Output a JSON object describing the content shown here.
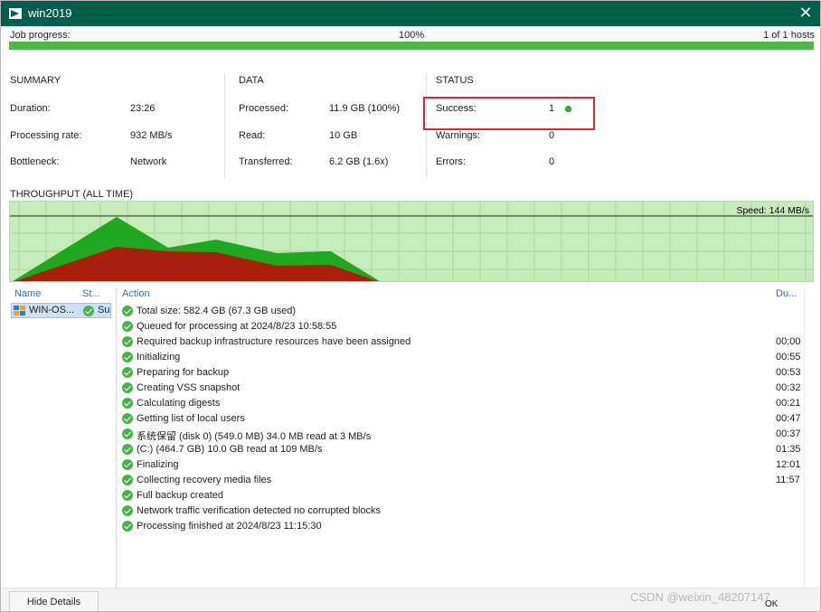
{
  "window": {
    "title": "win2019"
  },
  "job_progress": {
    "label": "Job progress:",
    "percent_label": "100%",
    "hosts": "1 of 1 hosts",
    "fraction": 1.0
  },
  "summary": {
    "header": "SUMMARY",
    "rows": [
      {
        "label": "Duration:",
        "value": "23:26"
      },
      {
        "label": "Processing rate:",
        "value": "932 MB/s"
      },
      {
        "label": "Bottleneck:",
        "value": "Network"
      }
    ]
  },
  "data": {
    "header": "DATA",
    "rows": [
      {
        "label": "Processed:",
        "value": "11.9 GB (100%)"
      },
      {
        "label": "Read:",
        "value": "10 GB"
      },
      {
        "label": "Transferred:",
        "value": "6.2 GB (1.6x)"
      }
    ]
  },
  "status": {
    "header": "STATUS",
    "rows": [
      {
        "label": "Success:",
        "value": "1"
      },
      {
        "label": "Warnings:",
        "value": "0"
      },
      {
        "label": "Errors:",
        "value": "0"
      }
    ]
  },
  "throughput": {
    "title": "THROUGHPUT (ALL TIME)",
    "speed": "Speed: 144 MB/s"
  },
  "vm_list": {
    "col_name": "Name",
    "col_status": "St...",
    "items": [
      {
        "name": "WIN-OS...",
        "status": "Su"
      }
    ]
  },
  "log": {
    "col_action": "Action",
    "col_duration": "Du...",
    "entries": [
      {
        "text": "Total size: 582.4 GB (67.3 GB used)",
        "duration": ""
      },
      {
        "text": "Queued for processing at 2024/8/23 10:58:55",
        "duration": ""
      },
      {
        "text": "Required backup infrastructure resources have been assigned",
        "duration": "00:00"
      },
      {
        "text": "Initializing",
        "duration": "00:55"
      },
      {
        "text": "Preparing for backup",
        "duration": "00:53"
      },
      {
        "text": "Creating VSS snapshot",
        "duration": "00:32"
      },
      {
        "text": "Calculating digests",
        "duration": "00:21"
      },
      {
        "text": "Getting list of local users",
        "duration": "00:47"
      },
      {
        "text": "系统保留 (disk 0) (549.0 MB) 34.0 MB read at 3 MB/s",
        "duration": "00:37"
      },
      {
        "text": "(C:) (464.7 GB) 10.0 GB read at 109 MB/s",
        "duration": "01:35"
      },
      {
        "text": "Finalizing",
        "duration": "12:01"
      },
      {
        "text": "Collecting recovery media files",
        "duration": "11:57"
      },
      {
        "text": "Full backup created",
        "duration": ""
      },
      {
        "text": "Network traffic verification detected no corrupted blocks",
        "duration": ""
      },
      {
        "text": "Processing finished at 2024/8/23 11:15:30",
        "duration": ""
      }
    ]
  },
  "footer": {
    "hide_details": "Hide Details",
    "ok": "OK"
  },
  "watermark": "CSDN @weixin_48207147",
  "colors": {
    "title_bar": "#005f4b",
    "progress": "#4cb848",
    "chart_bg": "#c6ecbc",
    "read_series": "#1fa71f",
    "transfer_series": "#a8200c",
    "highlight": "#e0242d"
  }
}
